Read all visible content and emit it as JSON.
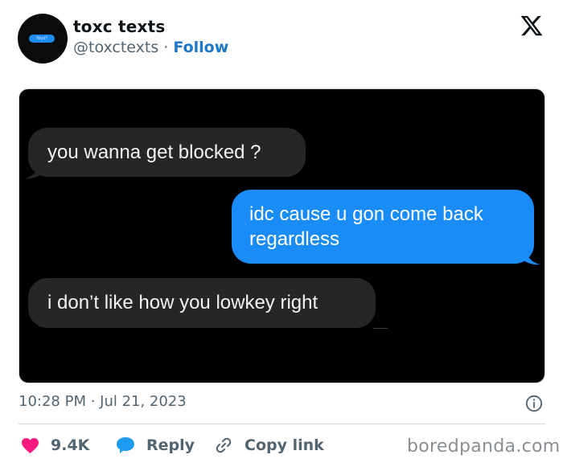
{
  "header": {
    "avatar_text": "Wyd?",
    "display_name": "toxc texts",
    "handle": "@toxctexts",
    "separator": "·",
    "follow_label": "Follow"
  },
  "media": {
    "messages": [
      {
        "side": "incoming",
        "text": "you wanna get blocked ?"
      },
      {
        "side": "outgoing",
        "line1": "idc cause u gon come back",
        "line2": "regardless"
      },
      {
        "side": "incoming",
        "text": "i don’t like how you lowkey right"
      }
    ]
  },
  "footer": {
    "timestamp": "10:28 PM · Jul 21, 2023",
    "likes": "9.4K",
    "reply_label": "Reply",
    "copy_label": "Copy link"
  },
  "watermark": "boredpanda.com",
  "colors": {
    "follow": "#1d78c9",
    "like_heart": "#f91880",
    "reply_icon": "#1d9bf0",
    "outgoing_bubble": "#1a8cf7",
    "incoming_bubble": "#262628"
  }
}
